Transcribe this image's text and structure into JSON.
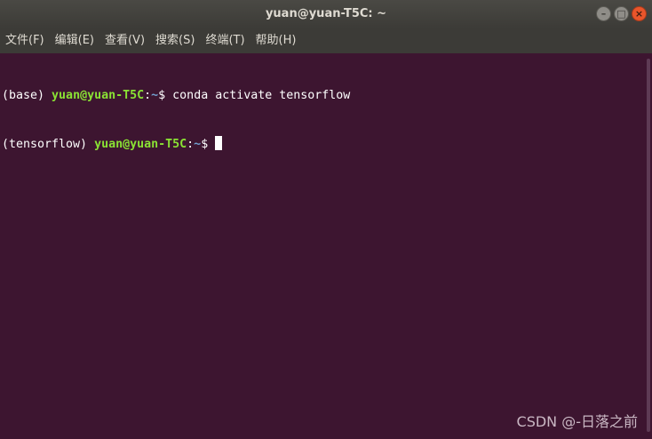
{
  "window": {
    "title": "yuan@yuan-T5C: ~",
    "controls": [
      "minimize",
      "maximize",
      "close"
    ]
  },
  "menubar": {
    "items": [
      "文件(F)",
      "编辑(E)",
      "查看(V)",
      "搜索(S)",
      "终端(T)",
      "帮助(H)"
    ]
  },
  "terminal": {
    "lines": [
      {
        "env": "(base) ",
        "user_host": "yuan@yuan-T5C",
        "sep": ":",
        "path": "~",
        "prompt": "$ ",
        "command": "conda activate tensorflow"
      },
      {
        "env": "(tensorflow) ",
        "user_host": "yuan@yuan-T5C",
        "sep": ":",
        "path": "~",
        "prompt": "$ ",
        "command": ""
      }
    ],
    "colors": {
      "background": "#3d1530",
      "text": "#ffffff",
      "user_host": "#8ae234",
      "path": "#729fcf"
    }
  },
  "watermark": "CSDN @-日落之前"
}
